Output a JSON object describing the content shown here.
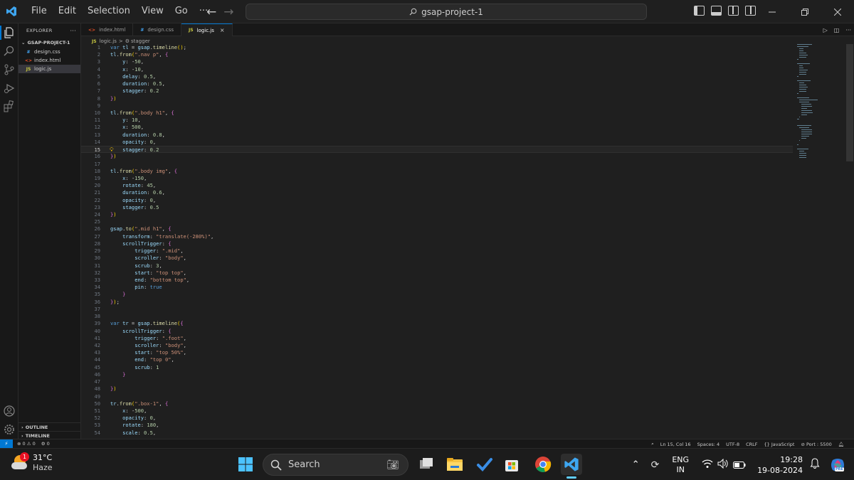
{
  "menu": [
    "File",
    "Edit",
    "Selection",
    "View",
    "Go",
    "···"
  ],
  "command_center": "gsap-project-1",
  "sidebar": {
    "title": "EXPLORER",
    "more": "···",
    "project": "GSAP-PROJECT-1",
    "files": [
      {
        "icon": "#",
        "name": "design.css"
      },
      {
        "icon": "<>",
        "name": "index.html"
      },
      {
        "icon": "JS",
        "name": "logic.js"
      }
    ],
    "outline": "OUTLINE",
    "timeline": "TIMELINE"
  },
  "tabs": [
    {
      "icon": "<>",
      "label": "index.html"
    },
    {
      "icon": "#",
      "label": "design.css"
    },
    {
      "icon": "JS",
      "label": "logic.js",
      "close": "×"
    }
  ],
  "breadcrumb": {
    "file": "logic.js",
    "sep": ">",
    "symbol_icon": "⚙",
    "symbol": "stagger"
  },
  "code": {
    "current_line": 15,
    "lines": [
      "var tl = gsap.timeline();",
      "tl.from(\".nav p\", {",
      "    y: -50,",
      "    x: -10,",
      "    delay: 0.5,",
      "    duration: 0.5,",
      "    stagger: 0.2",
      "})",
      "",
      "tl.from(\".body h1\", {",
      "    y: 10,",
      "    x: 500,",
      "    duration: 0.8,",
      "    opacity: 0,",
      "    stagger: 0.2",
      "})",
      "",
      "tl.from(\".body img\", {",
      "    x: -150,",
      "    rotate: 45,",
      "    duration: 0.6,",
      "    opacity: 0,",
      "    stagger: 0.5",
      "})",
      "",
      "gsap.to(\".mid h1\", {",
      "    transform: \"translate(-280%)\",",
      "    scrollTrigger: {",
      "        trigger: \".mid\",",
      "        scroller: \"body\",",
      "        scrub: 3,",
      "        start: \"top top\",",
      "        end: \"bottom top\",",
      "        pin: true",
      "    }",
      "});",
      "",
      "",
      "var tr = gsap.timeline({",
      "    scrollTrigger: {",
      "        trigger: \".foot\",",
      "        scroller: \"body\",",
      "        start: \"top 50%\",",
      "        end: \"top 0\",",
      "        scrub: 1",
      "    }",
      "",
      "})",
      "",
      "tr.from(\".box-1\", {",
      "    x: -500,",
      "    opacity: 0,",
      "    rotate: 180,",
      "    scale: 0.5,"
    ]
  },
  "statusbar": {
    "remote": "⚡",
    "problems": "⊗ 0 ⚠ 0",
    "ports": "⚙ 0",
    "position": "Ln 15, Col 16",
    "spaces": "Spaces: 4",
    "encoding": "UTF-8",
    "eol": "CRLF",
    "language": "{} JavaScript",
    "port": "⊘ Port : 5500"
  },
  "taskbar": {
    "weather_badge": "1",
    "temperature": "31°C",
    "condition": "Haze",
    "search": "Search",
    "lang_top": "ENG",
    "lang_bottom": "IN",
    "time": "19:28",
    "date": "19-08-2024",
    "copilot_badge": "PRE"
  },
  "colors": {
    "accent": "#0078d4",
    "keyword": "#569cd6",
    "string": "#ce9178",
    "number": "#b5cea8",
    "function": "#dcdcaa",
    "variable": "#9cdcfe"
  }
}
